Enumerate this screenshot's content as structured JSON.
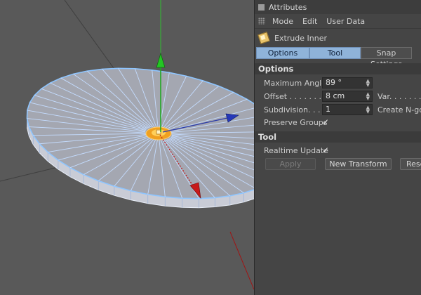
{
  "panel": {
    "title": "Attributes",
    "menu": [
      "Mode",
      "Edit",
      "User Data"
    ],
    "object_name": "Extrude Inner",
    "tabs": [
      "Options",
      "Tool",
      "Snap Settings"
    ],
    "sections": {
      "options": "Options",
      "tool": "Tool"
    },
    "fields": {
      "max_angle_label": "Maximum Angle",
      "max_angle_value": "89 °",
      "offset_label": "Offset . . . . . . .",
      "offset_value": "8 cm",
      "var_label": "Var. . . . . . . . .",
      "subdivision_label": "Subdivision. . . .",
      "subdivision_value": "1",
      "create_ngon_label": "Create N-gons",
      "preserve_groups_label": "Preserve Groups",
      "preserve_groups_check": "✓",
      "realtime_update_label": "Realtime Update",
      "realtime_update_check": "✓"
    },
    "buttons": {
      "apply": "Apply",
      "new_transform": "New Transform",
      "reset": "Reset Values"
    },
    "colors": {
      "tab_selected": "#8fb3d9",
      "panel_bg": "#454545"
    }
  },
  "viewport": {
    "icons": [
      "y-axis-arrow-icon",
      "x-axis-arrow-icon",
      "z-axis-arrow-icon",
      "selected-center-polygon-icon"
    ]
  }
}
